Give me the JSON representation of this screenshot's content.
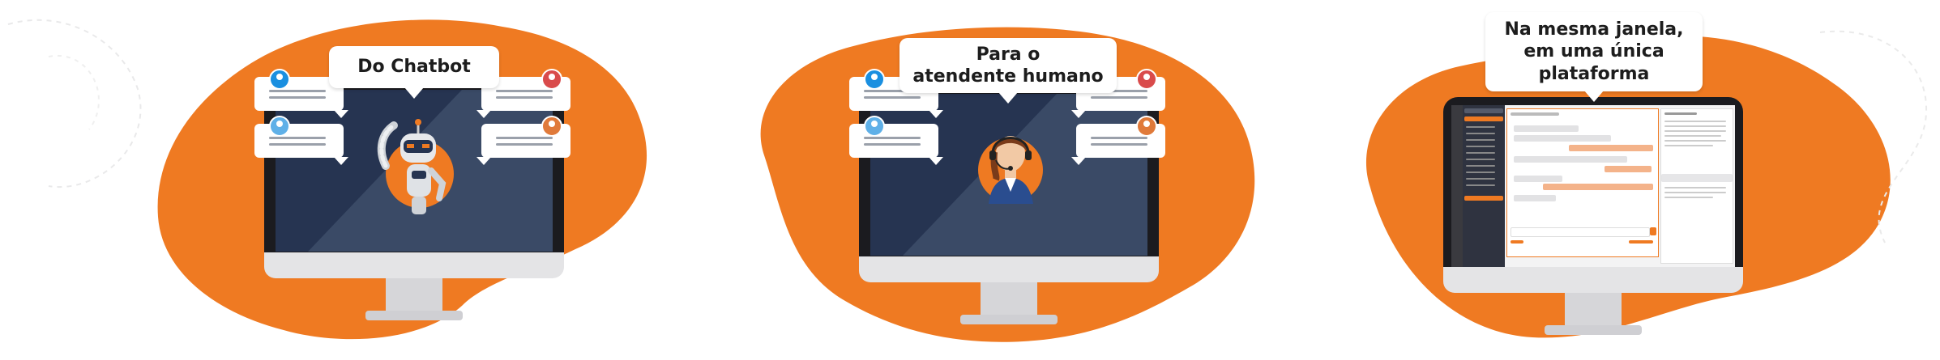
{
  "panels": [
    {
      "id": "chatbot",
      "caption": "Do Chatbot"
    },
    {
      "id": "agent",
      "caption_line1": "Para o",
      "caption_line2": "atendente humano"
    },
    {
      "id": "platform",
      "caption_line1": "Na mesma janela,",
      "caption_line2": "em uma única",
      "caption_line3": "plataforma"
    }
  ],
  "icons": {
    "robot": "robot-icon",
    "agent": "headset-agent-icon",
    "avatars": [
      "user-avatar-blue",
      "user-avatar-red",
      "user-avatar-lightblue",
      "user-avatar-orange"
    ]
  },
  "colors": {
    "orange": "#ef7a22",
    "screen_dark": "#263451",
    "screen_light": "#3a4a66",
    "bezel": "#1b1b1f",
    "avatar_blue": "#1a8fe0",
    "avatar_red": "#d94b4b",
    "avatar_lightblue": "#5fb0e8",
    "avatar_orange": "#e07a3a"
  }
}
